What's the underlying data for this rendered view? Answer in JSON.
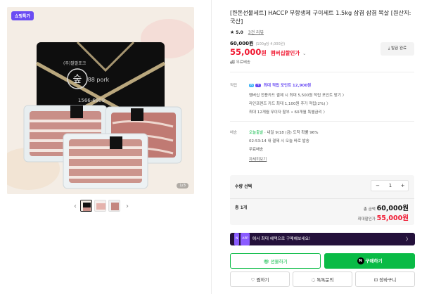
{
  "gallery": {
    "badge": "쇼핑특가",
    "counter": "1/3",
    "brand_text": "(주)팔팔포크",
    "brand_logo_text": "88 pork",
    "phone": "1566-6909",
    "prev_icon": "chevron-left-icon",
    "next_icon": "chevron-right-icon"
  },
  "product": {
    "title": "[한돈선물세트] HACCP 무항생제 구이세트 1.5kg 삼겹 삼겹 목살 [원산지:국산]",
    "rating": "5.0",
    "review_link": "3건 리뷰",
    "original_price": "60,000원",
    "unit_price": "(100g당 4,000원)",
    "sale_price": "55,000",
    "won": "원",
    "member_label": "멤버십할인가",
    "free_ship": "무료배송",
    "coupon_button": "발급 완료"
  },
  "benefits": {
    "label": "적립",
    "pill_n": "N",
    "pill_plus": "+",
    "max_point": "최대 적립 포인트",
    "max_point_value": "12,900원",
    "lines": [
      "멤버십 전용카드 결제 시 최대 5,500원 적립 포인트 받기 〉",
      "라인프렌즈 카드 최대 1,100원 추가 적립(2%) 〉",
      "최대 12개월 무이자 할부 • 60개월 특별금리 〉"
    ]
  },
  "shipping": {
    "label": "배송",
    "today": "오늘출발",
    "arrival": " · 내일 9/18 (금) 도착 확률 96%",
    "cutoff": "02:53:14  내 결제 시 오늘 바로 발송",
    "free": "무료배송",
    "detail": "자세히보기"
  },
  "option": {
    "title": "수량 선택",
    "minus": "−",
    "qty": "1",
    "plus": "+",
    "total_label": "총 1개",
    "total_price_label": "총 금액",
    "total_price": "60,000원",
    "min_price_label": "최대할인가",
    "min_price": "55,000원"
  },
  "banner": {
    "pill": "APP",
    "text": "에서 최대 혜택으로 구매해보세요!",
    "chevron": "〉"
  },
  "buttons": {
    "gift": "선물하기",
    "buy_logo": "N",
    "buy": "구매하기",
    "zzim": "찜하기",
    "talk": "톡톡문의",
    "cart": "장바구니"
  },
  "colors": {
    "accent_green": "#0abb46",
    "sale_red": "#f0162f",
    "purple": "#6a4cf3",
    "banner_bg": "#24113b"
  }
}
